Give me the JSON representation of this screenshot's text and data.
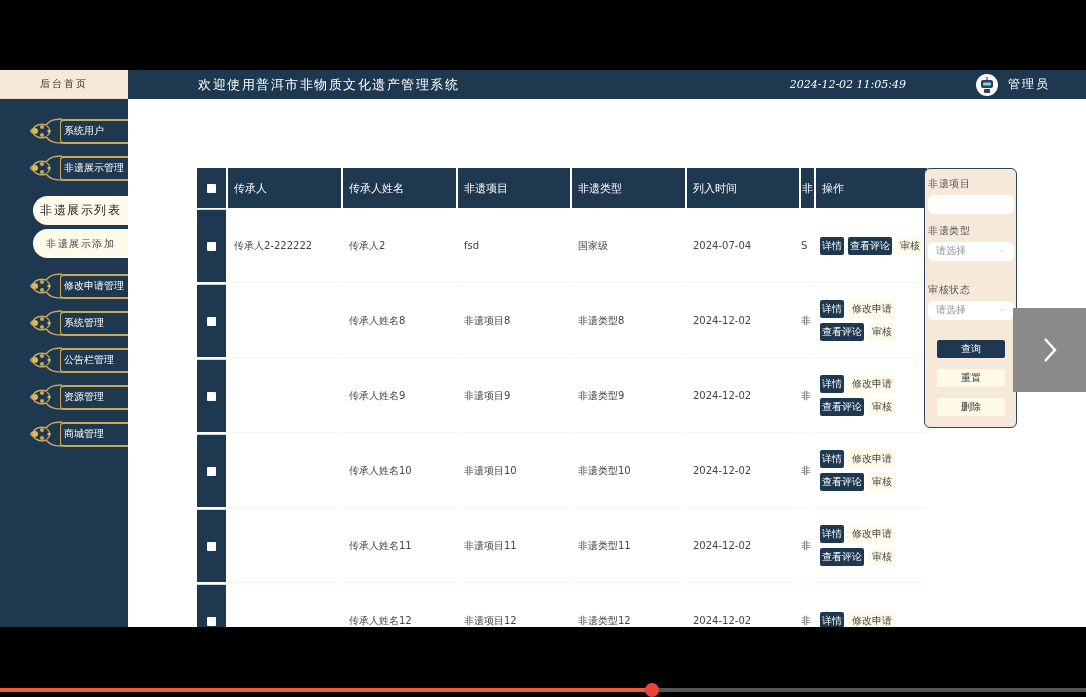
{
  "header": {
    "home": "后台首页",
    "title": "欢迎使用普洱市非物质文化遗产管理系统",
    "datetime": "2024-12-02 11:05:49",
    "user": "管理员"
  },
  "sidebar": {
    "items": [
      {
        "label": "系统用户"
      },
      {
        "label": "非遗展示管理",
        "children": [
          {
            "label": "非遗展示列表",
            "selected": true
          },
          {
            "label": "非遗展示添加",
            "selected": false
          }
        ]
      },
      {
        "label": "修改申请管理"
      },
      {
        "label": "系统管理"
      },
      {
        "label": "公告栏管理"
      },
      {
        "label": "资源管理"
      },
      {
        "label": "商城管理"
      }
    ]
  },
  "table": {
    "columns": [
      "传承人",
      "传承人姓名",
      "非遗项目",
      "非遗类型",
      "列入时间",
      "非",
      "操作"
    ],
    "header_checked": false,
    "rows": [
      {
        "checked": false,
        "cells": [
          "传承人2-222222",
          "传承人2",
          "fsd",
          "国家级",
          "2024-07-04",
          "S"
        ],
        "action_lines": [
          [
            {
              "label": "详情",
              "kind": "primary"
            },
            {
              "label": "查看评论",
              "kind": "primary"
            },
            {
              "label": "审核",
              "kind": "secondary"
            }
          ]
        ]
      },
      {
        "checked": false,
        "cells": [
          "",
          "传承人姓名8",
          "非遗项目8",
          "非遗类型8",
          "2024-12-02",
          "非"
        ],
        "action_lines": [
          [
            {
              "label": "详情",
              "kind": "primary"
            },
            {
              "label": "修改申请",
              "kind": "secondary"
            }
          ],
          [
            {
              "label": "查看评论",
              "kind": "primary"
            },
            {
              "label": "审核",
              "kind": "secondary"
            }
          ]
        ]
      },
      {
        "checked": false,
        "cells": [
          "",
          "传承人姓名9",
          "非遗项目9",
          "非遗类型9",
          "2024-12-02",
          "非"
        ],
        "action_lines": [
          [
            {
              "label": "详情",
              "kind": "primary"
            },
            {
              "label": "修改申请",
              "kind": "secondary"
            }
          ],
          [
            {
              "label": "查看评论",
              "kind": "primary"
            },
            {
              "label": "审核",
              "kind": "secondary"
            }
          ]
        ]
      },
      {
        "checked": false,
        "cells": [
          "",
          "传承人姓名10",
          "非遗项目10",
          "非遗类型10",
          "2024-12-02",
          "非"
        ],
        "action_lines": [
          [
            {
              "label": "详情",
              "kind": "primary"
            },
            {
              "label": "修改申请",
              "kind": "secondary"
            }
          ],
          [
            {
              "label": "查看评论",
              "kind": "primary"
            },
            {
              "label": "审核",
              "kind": "secondary"
            }
          ]
        ]
      },
      {
        "checked": false,
        "cells": [
          "",
          "传承人姓名11",
          "非遗项目11",
          "非遗类型11",
          "2024-12-02",
          "非"
        ],
        "action_lines": [
          [
            {
              "label": "详情",
              "kind": "primary"
            },
            {
              "label": "修改申请",
              "kind": "secondary"
            }
          ],
          [
            {
              "label": "查看评论",
              "kind": "primary"
            },
            {
              "label": "审核",
              "kind": "secondary"
            }
          ]
        ]
      },
      {
        "checked": false,
        "cells": [
          "",
          "传承人姓名12",
          "非遗项目12",
          "非遗类型12",
          "2024-12-02",
          "非"
        ],
        "action_lines": [
          [
            {
              "label": "详情",
              "kind": "primary"
            },
            {
              "label": "修改申请",
              "kind": "secondary"
            }
          ]
        ]
      }
    ]
  },
  "filter": {
    "fields": [
      {
        "label": "非遗项目",
        "kind": "input"
      },
      {
        "label": "非遗类型",
        "kind": "select",
        "placeholder": "请选择"
      },
      {
        "label": "审核状态",
        "kind": "select",
        "placeholder": "请选择"
      }
    ],
    "buttons": [
      {
        "label": "查询",
        "kind": "primary"
      },
      {
        "label": "重置",
        "kind": "secondary"
      },
      {
        "label": "删除",
        "kind": "secondary"
      }
    ]
  },
  "player": {
    "level": 0.6
  }
}
